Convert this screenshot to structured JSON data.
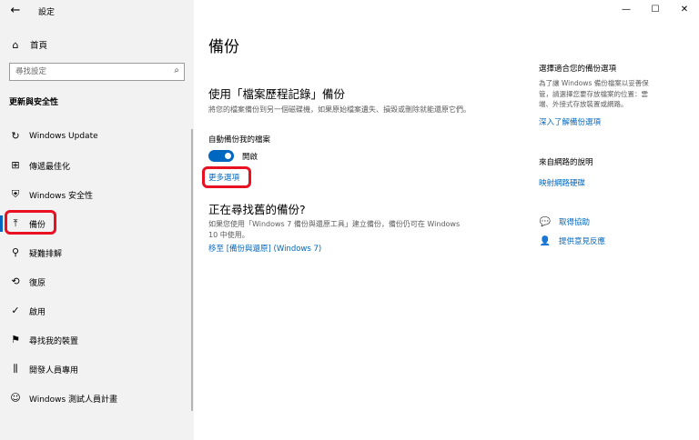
{
  "window": {
    "title": "設定",
    "back_icon": "back-arrow-icon",
    "controls": {
      "minimize": "—",
      "maximize": "☐",
      "close": "✕"
    }
  },
  "sidebar": {
    "home": {
      "label": "首頁",
      "icon": "home-icon"
    },
    "search": {
      "placeholder": "尋找設定",
      "icon": "search-icon"
    },
    "section_label": "更新與安全性",
    "items": [
      {
        "label": "Windows Update",
        "icon": "refresh-icon",
        "selected": false
      },
      {
        "label": "傳遞最佳化",
        "icon": "delivery-optimization-icon",
        "selected": false
      },
      {
        "label": "Windows 安全性",
        "icon": "shield-icon",
        "selected": false
      },
      {
        "label": "備份",
        "icon": "backup-upload-icon",
        "selected": true
      },
      {
        "label": "疑難排解",
        "icon": "wrench-icon",
        "selected": false
      },
      {
        "label": "復原",
        "icon": "recovery-icon",
        "selected": false
      },
      {
        "label": "啟用",
        "icon": "check-circle-icon",
        "selected": false
      },
      {
        "label": "尋找我的裝置",
        "icon": "find-device-icon",
        "selected": false
      },
      {
        "label": "開發人員專用",
        "icon": "developer-icon",
        "selected": false
      },
      {
        "label": "Windows 測試人員計畫",
        "icon": "insider-icon",
        "selected": false
      }
    ]
  },
  "main": {
    "title": "備份",
    "file_history": {
      "heading": "使用「檔案歷程記錄」備份",
      "description": "將您的檔案備份到另一個磁碟機，如果原始檔案遺失、損毀或刪除就能還原它們。",
      "auto_backup_label": "自動備份我的檔案",
      "toggle_state": "開啟",
      "toggle_on": true,
      "more_options": "更多選項"
    },
    "older_backup": {
      "heading": "正在尋找舊的備份?",
      "description": "如果您使用「Windows 7 備份與還原工具」建立備份，備份仍可在 Windows 10 中使用。",
      "link": "移至 [備份與還原] (Windows 7)"
    }
  },
  "right_panel": {
    "choose_heading": "選擇適合您的備份選項",
    "choose_desc": "為了讓 Windows 備份檔案以妥善保管，請選擇您要存放檔案的位置：雲端、外接式存放裝置或網路。",
    "choose_link": "深入了解備份選項",
    "web_help_heading": "來自網路的說明",
    "web_help_link": "映射網路硬碟",
    "get_help": {
      "label": "取得協助",
      "icon": "help-chat-icon"
    },
    "feedback": {
      "label": "提供意見反應",
      "icon": "feedback-icon"
    }
  },
  "colors": {
    "accent": "#0067c0",
    "annotation_red": "#e81123",
    "sidebar_bg": "#f2f2f2"
  }
}
